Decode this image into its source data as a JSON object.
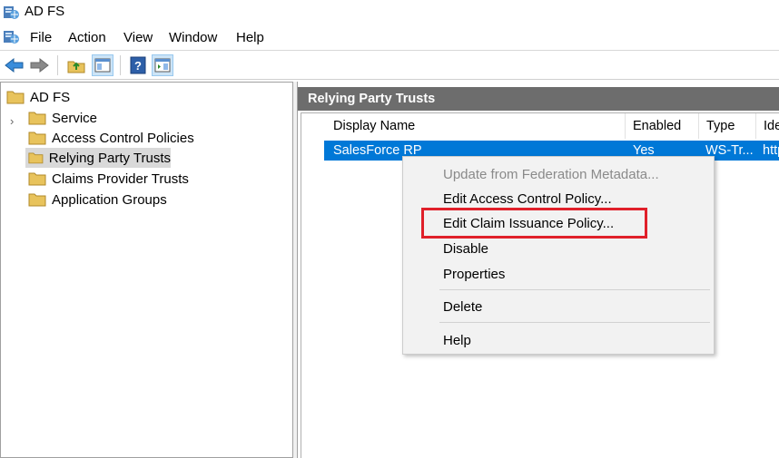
{
  "window": {
    "title": "AD FS"
  },
  "menu": {
    "items": [
      "File",
      "Action",
      "View",
      "Window",
      "Help"
    ]
  },
  "tree": {
    "root": "AD FS",
    "items": [
      {
        "label": "Service"
      },
      {
        "label": "Access Control Policies"
      },
      {
        "label": "Relying Party Trusts",
        "selected": true
      },
      {
        "label": "Claims Provider Trusts"
      },
      {
        "label": "Application Groups"
      }
    ]
  },
  "right_pane": {
    "header": "Relying Party Trusts",
    "columns": [
      "Display Name",
      "Enabled",
      "Type",
      "Ide"
    ],
    "rows": [
      {
        "display_name": "SalesForce RP",
        "enabled": "Yes",
        "type": "WS-Tr...",
        "identifier": "http"
      }
    ]
  },
  "context_menu": {
    "items": [
      {
        "label": "Update from Federation Metadata...",
        "disabled": true
      },
      {
        "label": "Edit Access Control Policy..."
      },
      {
        "label": "Edit Claim Issuance Policy...",
        "highlighted": true
      },
      {
        "label": "Disable"
      },
      {
        "label": "Properties"
      },
      {
        "label": "Delete"
      },
      {
        "label": "Help"
      }
    ]
  },
  "toolbar": {
    "icons": [
      "back-arrow-icon",
      "forward-arrow-icon",
      "up-folder-icon",
      "show-hide-tree-icon",
      "help-icon",
      "action-pane-icon"
    ]
  },
  "colors": {
    "selection": "#0078d7",
    "header_bar": "#6d6d6d",
    "highlight_box": "#e0202a",
    "folder": "#e8c35c"
  }
}
